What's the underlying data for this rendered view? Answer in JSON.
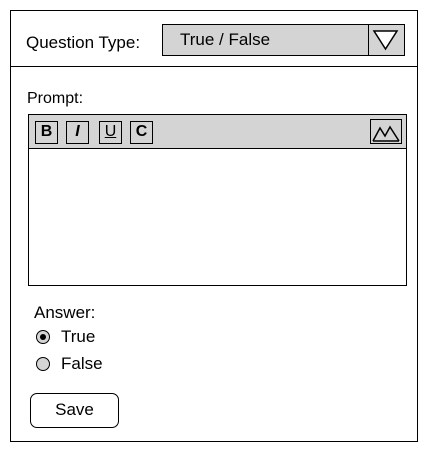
{
  "question_type": {
    "label": "Question Type:",
    "selected_value": "True / False",
    "arrow_icon": "chevron-down-icon"
  },
  "prompt": {
    "label": "Prompt:",
    "toolbar": {
      "bold_label": "B",
      "italic_label": "I",
      "underline_label": "U",
      "code_label": "C",
      "image_icon": "image-icon"
    },
    "content": ""
  },
  "answer": {
    "label": "Answer:",
    "options": [
      {
        "label": "True",
        "selected": true
      },
      {
        "label": "False",
        "selected": false
      }
    ]
  },
  "save_label": "Save",
  "colors": {
    "control_fill": "#d4d4d4",
    "border": "#000000",
    "background": "#ffffff"
  }
}
